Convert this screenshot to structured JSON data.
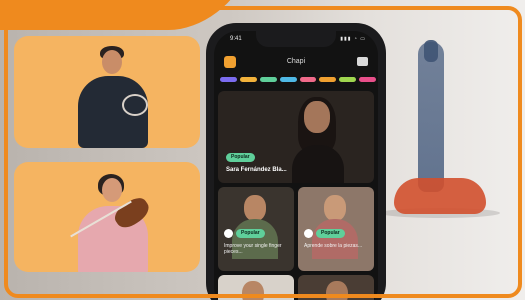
{
  "phone": {
    "status_time": "9:41",
    "status_icons": "▮▮▮ ◔ ▭",
    "app_title": "Chapi",
    "categories": [
      {
        "color": "#7b6cf0"
      },
      {
        "color": "#f2b23b"
      },
      {
        "color": "#5fcf9a"
      },
      {
        "color": "#4fb9e6"
      },
      {
        "color": "#f06a8a"
      },
      {
        "color": "#f0a030"
      },
      {
        "color": "#9fd64f"
      },
      {
        "color": "#e84f8a"
      }
    ],
    "featured": {
      "badge": "Popular",
      "name": "Sara Fernández Bla..."
    },
    "cards": [
      {
        "badge": "Popular",
        "text": "Improve your single finger pieces..."
      },
      {
        "badge": "Popular",
        "text": "Aprende sobre la piezas..."
      }
    ]
  },
  "colors": {
    "brand": "#ef8a1e",
    "panel": "#f5b461",
    "badge": "#5fcf9a"
  },
  "icons": {
    "menu": "menu-icon",
    "chat": "chat-icon",
    "play": "play-icon"
  }
}
